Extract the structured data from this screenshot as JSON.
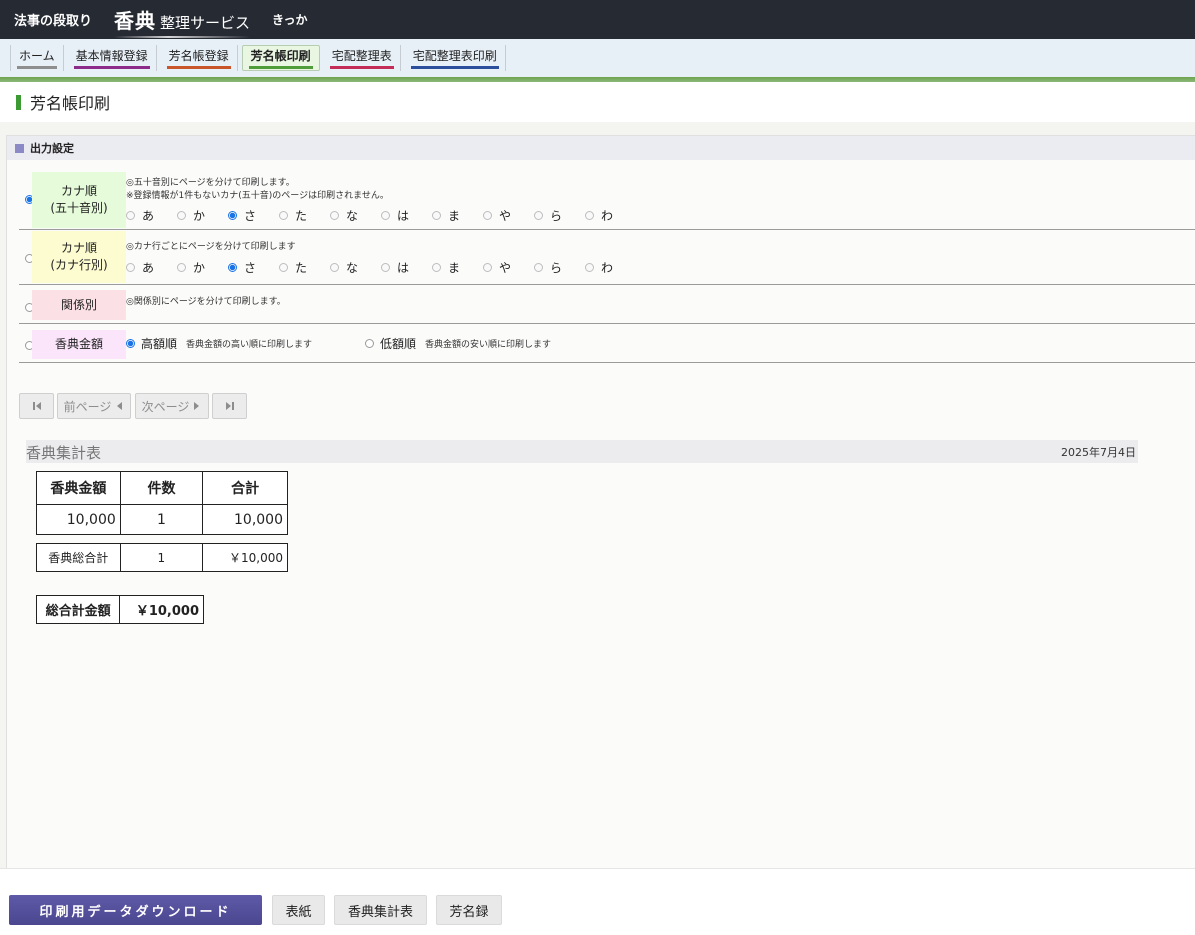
{
  "header": {
    "brand": "法事の段取り",
    "logo_kanji": "香典",
    "logo_text": "整理サービス",
    "user": "きっか"
  },
  "nav": [
    {
      "label": "ホーム",
      "color": "#8e8e8e"
    },
    {
      "label": "基本情報登録",
      "color": "#8c2b8a"
    },
    {
      "label": "芳名帳登録",
      "color": "#c8562a"
    },
    {
      "label": "芳名帳印刷",
      "color": "#4f9c3a",
      "active": true
    },
    {
      "label": "宅配整理表",
      "color": "#c42c58"
    },
    {
      "label": "宅配整理表印刷",
      "color": "#2b4f9c"
    }
  ],
  "page_title": "芳名帳印刷",
  "output": {
    "heading": "出力設定",
    "options": [
      {
        "line1": "カナ順",
        "line2": "(五十音別)",
        "bg": "#e5fbd9",
        "selected": true,
        "note1": "◎五十音別にページを分けて印刷します。",
        "note2": "※登録情報が1件もないカナ(五十音)のページは印刷されません。",
        "kana_selected": "さ"
      },
      {
        "line1": "カナ順",
        "line2": "(カナ行別)",
        "bg": "#fdfbd0",
        "selected": false,
        "note1": "◎カナ行ごとにページを分けて印刷します",
        "kana_selected": "さ"
      },
      {
        "line1": "関係別",
        "bg": "#fbe0e6",
        "selected": false,
        "note1": "◎関係別にページを分けて印刷します。"
      },
      {
        "line1": "香典金額",
        "bg": "#fbe5fb",
        "selected": false,
        "sort_high": {
          "label": "高額順",
          "desc": "香典金額の高い順に印刷します",
          "selected": true
        },
        "sort_low": {
          "label": "低額順",
          "desc": "香典金額の安い順に印刷します",
          "selected": false
        }
      }
    ],
    "kana": [
      "あ",
      "か",
      "さ",
      "た",
      "な",
      "は",
      "ま",
      "や",
      "ら",
      "わ"
    ]
  },
  "pager": {
    "first_icon": "first-page-icon",
    "prev": "前ページ",
    "next": "次ページ",
    "last_icon": "last-page-icon"
  },
  "summary": {
    "title": "香典集計表",
    "date": "2025年7月4日",
    "headers": [
      "香典金額",
      "件数",
      "合計"
    ],
    "rows": [
      {
        "amount": "10,000",
        "count": "1",
        "total": "10,000"
      }
    ],
    "subtotal": {
      "label": "香典総合計",
      "count": "1",
      "total": "￥10,000"
    },
    "grand": {
      "label": "総合計金額",
      "value": "￥10,000"
    }
  },
  "buttons": {
    "download": "印刷用データダウンロード",
    "cover": "表紙",
    "summary": "香典集計表",
    "registry": "芳名録"
  }
}
